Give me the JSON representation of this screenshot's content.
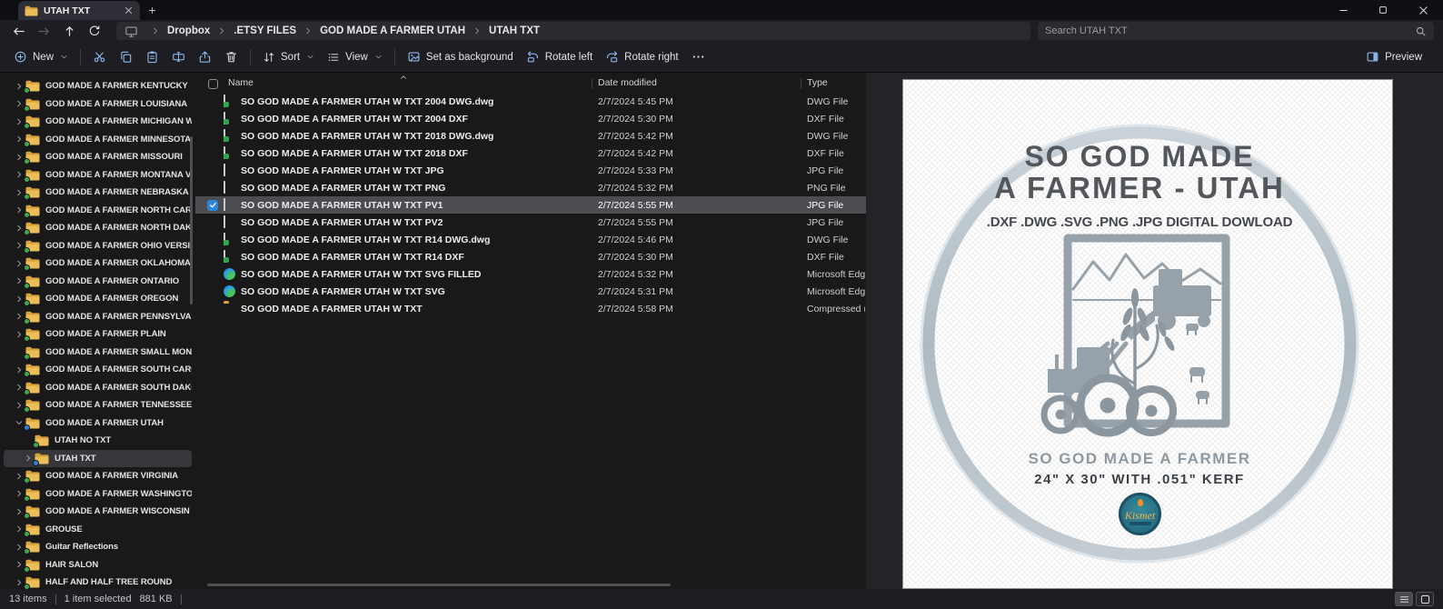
{
  "window": {
    "tab_title": "UTAH TXT"
  },
  "address": {
    "breadcrumbs": [
      "Dropbox",
      ".ETSY FILES",
      "GOD MADE A FARMER UTAH",
      "UTAH TXT"
    ],
    "search_placeholder": "Search UTAH TXT"
  },
  "toolbar": {
    "new": "New",
    "sort": "Sort",
    "view": "View",
    "set_as_background": "Set as background",
    "rotate_left": "Rotate left",
    "rotate_right": "Rotate right",
    "preview": "Preview"
  },
  "sidebar": {
    "items": [
      {
        "label": "GOD MADE A FARMER KENTUCKY",
        "chevron": "right",
        "badge": "green",
        "indent": 0,
        "selected": false
      },
      {
        "label": "GOD MADE A FARMER LOUISIANA",
        "chevron": "right",
        "badge": "green",
        "indent": 0,
        "selected": false
      },
      {
        "label": "GOD MADE A FARMER MICHIGAN WITH UP",
        "chevron": "right",
        "badge": "green",
        "indent": 0,
        "selected": false
      },
      {
        "label": "GOD MADE A FARMER MINNESOTA",
        "chevron": "right",
        "badge": "green",
        "indent": 0,
        "selected": false
      },
      {
        "label": "GOD MADE A FARMER MISSOURI",
        "chevron": "right",
        "badge": "green",
        "indent": 0,
        "selected": false
      },
      {
        "label": "GOD MADE A FARMER MONTANA VERSION",
        "chevron": "right",
        "badge": "green",
        "indent": 0,
        "selected": false
      },
      {
        "label": "GOD MADE A FARMER NEBRASKA",
        "chevron": "right",
        "badge": "green",
        "indent": 0,
        "selected": false
      },
      {
        "label": "GOD MADE A FARMER NORTH CAROLINA",
        "chevron": "right",
        "badge": "green",
        "indent": 0,
        "selected": false
      },
      {
        "label": "GOD MADE A FARMER NORTH DAKOTA",
        "chevron": "right",
        "badge": "green",
        "indent": 0,
        "selected": false
      },
      {
        "label": "GOD MADE A FARMER OHIO VERSION",
        "chevron": "right",
        "badge": "green",
        "indent": 0,
        "selected": false
      },
      {
        "label": "GOD MADE A FARMER OKLAHOMA",
        "chevron": "right",
        "badge": "green",
        "indent": 0,
        "selected": false
      },
      {
        "label": "GOD MADE A FARMER ONTARIO",
        "chevron": "right",
        "badge": "green",
        "indent": 0,
        "selected": false
      },
      {
        "label": "GOD MADE A FARMER OREGON",
        "chevron": "right",
        "badge": "green",
        "indent": 0,
        "selected": false
      },
      {
        "label": "GOD MADE A FARMER PENNSYLVANIA",
        "chevron": "right",
        "badge": "green",
        "indent": 0,
        "selected": false
      },
      {
        "label": "GOD MADE A FARMER PLAIN",
        "chevron": "right",
        "badge": "green",
        "indent": 0,
        "selected": false
      },
      {
        "label": "GOD MADE A FARMER SMALL MONTANA VERSIO",
        "chevron": "none",
        "badge": "green",
        "indent": 0,
        "selected": false
      },
      {
        "label": "GOD MADE A FARMER SOUTH CAROLINA",
        "chevron": "right",
        "badge": "green",
        "indent": 0,
        "selected": false
      },
      {
        "label": "GOD MADE A FARMER SOUTH DAKOTA",
        "chevron": "right",
        "badge": "green",
        "indent": 0,
        "selected": false
      },
      {
        "label": "GOD MADE A FARMER TENNESSEE",
        "chevron": "right",
        "badge": "green",
        "indent": 0,
        "selected": false
      },
      {
        "label": "GOD MADE A FARMER UTAH",
        "chevron": "down",
        "badge": "blue",
        "indent": 0,
        "selected": false
      },
      {
        "label": "UTAH NO TXT",
        "chevron": "none",
        "badge": "green",
        "indent": 1,
        "selected": false
      },
      {
        "label": "UTAH TXT",
        "chevron": "right",
        "badge": "blue",
        "indent": 1,
        "selected": true
      },
      {
        "label": "GOD MADE A FARMER VIRGINIA",
        "chevron": "right",
        "badge": "green",
        "indent": 0,
        "selected": false
      },
      {
        "label": "GOD MADE A FARMER WASHINGTON",
        "chevron": "right",
        "badge": "green",
        "indent": 0,
        "selected": false
      },
      {
        "label": "GOD MADE A FARMER WISCONSIN",
        "chevron": "right",
        "badge": "green",
        "indent": 0,
        "selected": false
      },
      {
        "label": "GROUSE",
        "chevron": "right",
        "badge": "green",
        "indent": 0,
        "selected": false
      },
      {
        "label": "Guitar Reflections",
        "chevron": "right",
        "badge": "green",
        "indent": 0,
        "selected": false
      },
      {
        "label": "HAIR SALON",
        "chevron": "right",
        "badge": "green",
        "indent": 0,
        "selected": false
      },
      {
        "label": "HALF AND HALF TREE ROUND",
        "chevron": "right",
        "badge": "green",
        "indent": 0,
        "selected": false
      }
    ]
  },
  "files": {
    "columns": {
      "name": "Name",
      "date": "Date modified",
      "type": "Type"
    },
    "rows": [
      {
        "name": "SO GOD MADE A FARMER UTAH W TXT 2004 DWG.dwg",
        "date": "2/7/2024 5:45 PM",
        "type": "DWG File",
        "icon": "dwg",
        "selected": false
      },
      {
        "name": "SO GOD MADE A FARMER UTAH W TXT 2004 DXF",
        "date": "2/7/2024 5:30 PM",
        "type": "DXF File",
        "icon": "dwg",
        "selected": false
      },
      {
        "name": "SO GOD MADE A FARMER UTAH W TXT 2018 DWG.dwg",
        "date": "2/7/2024 5:42 PM",
        "type": "DWG File",
        "icon": "dwg",
        "selected": false
      },
      {
        "name": "SO GOD MADE A FARMER UTAH W TXT 2018 DXF",
        "date": "2/7/2024 5:42 PM",
        "type": "DXF File",
        "icon": "dwg",
        "selected": false
      },
      {
        "name": "SO GOD MADE A FARMER UTAH W TXT JPG",
        "date": "2/7/2024 5:33 PM",
        "type": "JPG File",
        "icon": "img",
        "selected": false
      },
      {
        "name": "SO GOD MADE A FARMER UTAH W TXT PNG",
        "date": "2/7/2024 5:32 PM",
        "type": "PNG File",
        "icon": "img",
        "selected": false
      },
      {
        "name": "SO GOD MADE A FARMER UTAH W TXT PV1",
        "date": "2/7/2024 5:55 PM",
        "type": "JPG File",
        "icon": "img",
        "selected": true
      },
      {
        "name": "SO GOD MADE A FARMER UTAH W TXT PV2",
        "date": "2/7/2024 5:55 PM",
        "type": "JPG File",
        "icon": "img",
        "selected": false
      },
      {
        "name": "SO GOD MADE A FARMER UTAH W TXT R14 DWG.dwg",
        "date": "2/7/2024 5:46 PM",
        "type": "DWG File",
        "icon": "dwg",
        "selected": false
      },
      {
        "name": "SO GOD MADE A FARMER UTAH W TXT R14 DXF",
        "date": "2/7/2024 5:30 PM",
        "type": "DXF File",
        "icon": "dwg",
        "selected": false
      },
      {
        "name": "SO GOD MADE A FARMER UTAH W TXT SVG FILLED",
        "date": "2/7/2024 5:32 PM",
        "type": "Microsoft Edge",
        "icon": "edge",
        "selected": false
      },
      {
        "name": "SO GOD MADE A FARMER UTAH W TXT SVG",
        "date": "2/7/2024 5:31 PM",
        "type": "Microsoft Edge",
        "icon": "edge",
        "selected": false
      },
      {
        "name": "SO GOD MADE A FARMER UTAH W TXT",
        "date": "2/7/2024 5:58 PM",
        "type": "Compressed (zip",
        "icon": "zip",
        "selected": false
      }
    ]
  },
  "preview_pane": {
    "line1": "SO GOD MADE",
    "line2": "A FARMER - UTAH",
    "formats": ".DXF .DWG .SVG .PNG .JPG DIGITAL DOWLOAD",
    "design_caption": "SO GOD MADE A FARMER",
    "dimensions": "24\" X 30\" WITH .051\" KERF",
    "logo": "Kismet"
  },
  "status": {
    "count": "13 items",
    "selected": "1 item selected",
    "size": "881 KB"
  },
  "colors": {
    "accent_blue": "#2f7fd6",
    "selection_gray": "#4b4d50",
    "badge_green": "#3fa64d",
    "folder_yellow": "#e9b751"
  }
}
